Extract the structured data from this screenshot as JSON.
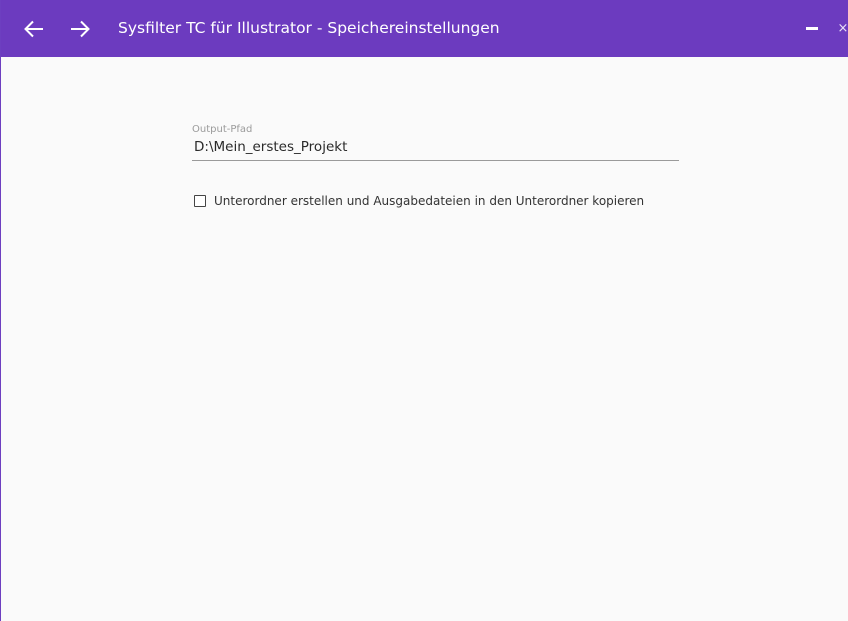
{
  "window": {
    "title": "Sysfilter TC für Illustrator - Speichereinstellungen",
    "accent_color": "#6c3bbf",
    "nav": {
      "back_icon": "arrow-left-icon",
      "forward_icon": "arrow-right-icon"
    },
    "controls": {
      "minimize_icon": "minimize-icon",
      "close_icon": "close-icon",
      "close_glyph": "×"
    }
  },
  "settings": {
    "output_path": {
      "label": "Output-Pfad",
      "value": "D:\\Mein_erstes_Projekt"
    },
    "subfolder_option": {
      "label": "Unterordner erstellen und Ausgabedateien in den Unterordner kopieren",
      "checked": false
    }
  }
}
